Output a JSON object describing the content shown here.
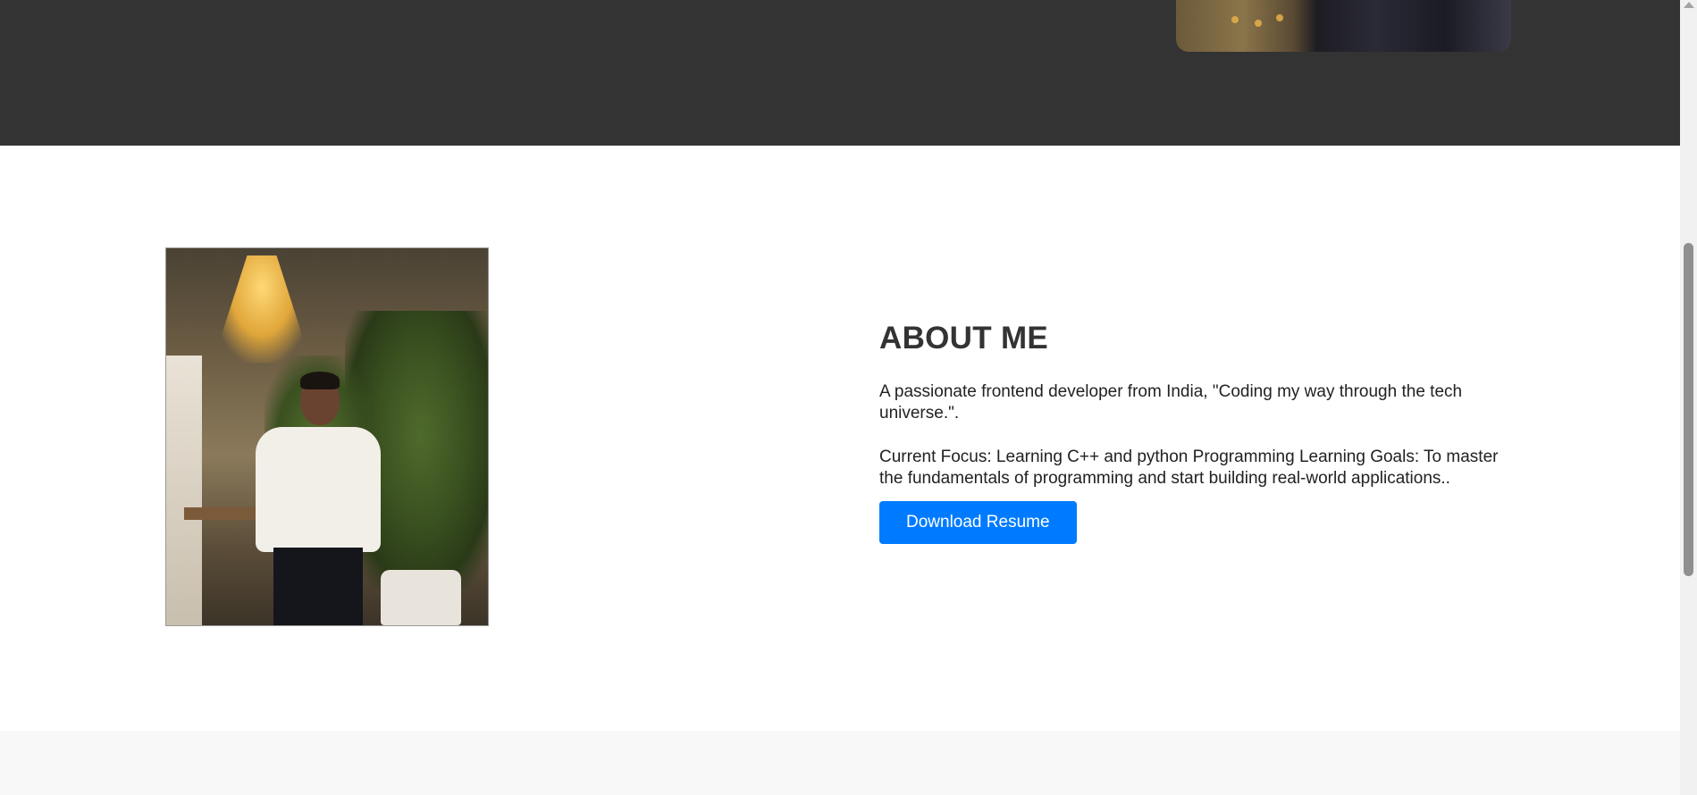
{
  "about": {
    "title": "ABOUT ME",
    "intro": "A passionate frontend developer from India, \"Coding my way through the tech universe.\".",
    "focus": "Current Focus: Learning C++ and python Programming Learning Goals: To master the fundamentals of programming and start building real-world applications..",
    "resume_button": "Download Resume",
    "photo_icon": "profile-photo"
  },
  "colors": {
    "hero_bg": "#333333",
    "accent": "#007bff",
    "text": "#333333",
    "next_section_bg": "#f8f8f8"
  }
}
